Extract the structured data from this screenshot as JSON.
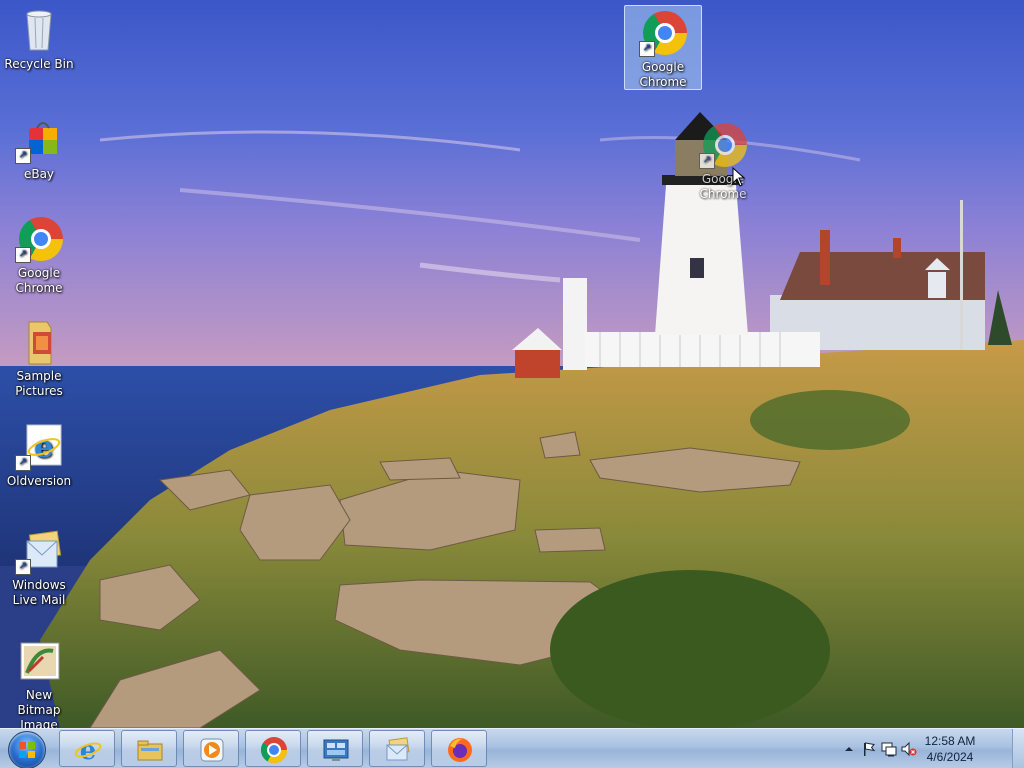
{
  "desktop": {
    "icons": [
      {
        "label": "Recycle Bin",
        "icon": "recycle-bin-icon"
      },
      {
        "label": "eBay",
        "icon": "ebay-icon"
      },
      {
        "label": "Google Chrome",
        "icon": "chrome-icon"
      },
      {
        "label": "Sample Pictures",
        "icon": "folder-pictures-icon"
      },
      {
        "label": "Oldversion",
        "icon": "internet-explorer-icon"
      },
      {
        "label": "Windows Live Mail",
        "icon": "windows-live-mail-icon"
      },
      {
        "label": "New Bitmap Image",
        "icon": "bitmap-image-icon"
      },
      {
        "label": "Google Chrome",
        "icon": "chrome-icon",
        "selected": true
      },
      {
        "label": "Google Chrome",
        "icon": "chrome-icon",
        "dragging": true
      }
    ]
  },
  "taskbar": {
    "start": {
      "icon": "windows-start-orb"
    },
    "buttons": [
      {
        "icon": "internet-explorer-icon",
        "name": "Internet Explorer"
      },
      {
        "icon": "file-explorer-icon",
        "name": "Windows Explorer"
      },
      {
        "icon": "media-player-icon",
        "name": "Windows Media Player"
      },
      {
        "icon": "chrome-icon",
        "name": "Google Chrome"
      },
      {
        "icon": "control-panel-icon",
        "name": "Control Panel"
      },
      {
        "icon": "mail-icon",
        "name": "Windows Live Mail"
      },
      {
        "icon": "firefox-icon",
        "name": "Firefox"
      }
    ],
    "tray": {
      "icons": [
        "show-hidden-icons-icon",
        "action-center-flag-icon",
        "network-icon",
        "volume-muted-icon"
      ],
      "time": "12:58 AM",
      "date": "4/6/2024"
    }
  },
  "colors": {
    "sky": "#3d59c9",
    "taskbar": "#a9c2e1",
    "selection": "#adcdf0"
  }
}
